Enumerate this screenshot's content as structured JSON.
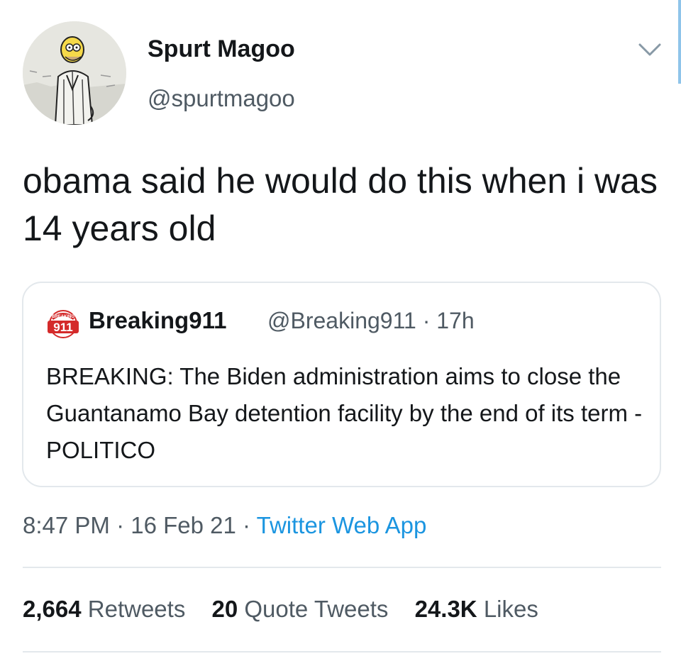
{
  "author": {
    "display_name": "Spurt Magoo",
    "handle": "@spurtmagoo",
    "avatar_icon": "cartoon-character-avatar-icon"
  },
  "tweet": {
    "text": "obama said he would do this when i was 14 years old"
  },
  "quoted_tweet": {
    "logo_text": "911",
    "logo_banner": "BREAKING",
    "display_name": "Breaking911",
    "handle": "@Breaking911",
    "separator": "·",
    "age": "17h",
    "text": "BREAKING: The Biden administration aims to close the Guantanamo Bay detention facility by the end of its term -POLITICO",
    "logo_color": "#d42a2a"
  },
  "meta": {
    "time": "8:47 PM",
    "separator": "·",
    "date": "16 Feb 21",
    "source": "Twitter Web App",
    "source_color": "#1b95e0"
  },
  "stats": {
    "retweets_count": "2,664",
    "retweets_label": "Retweets",
    "quotes_count": "20",
    "quotes_label": "Quote Tweets",
    "likes_count": "24.3K",
    "likes_label": "Likes"
  },
  "icons": {
    "menu": "chevron-down-icon"
  }
}
